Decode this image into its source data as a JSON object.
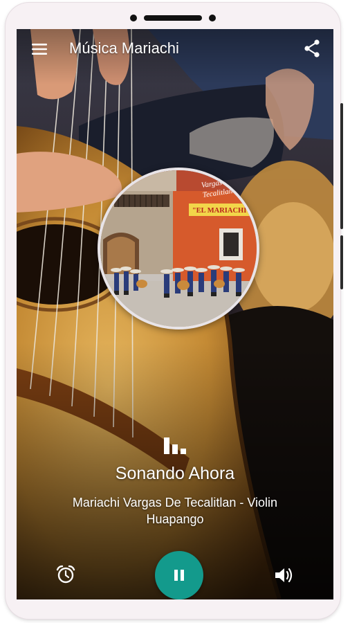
{
  "app_bar": {
    "title": "Música Mariachi",
    "menu_icon": "hamburger-menu-icon",
    "share_icon": "share-icon"
  },
  "album_art": {
    "sign_text": "\"EL MARIACHI\"",
    "logo_text": "Vargas de Tecalitlan"
  },
  "now_playing": {
    "icon": "equalizer-icon",
    "heading": "Sonando Ahora",
    "track": "Mariachi Vargas De Tecalitlan - Violin Huapango"
  },
  "controls": {
    "alarm_icon": "alarm-clock-icon",
    "play_pause_icon": "pause-icon",
    "volume_icon": "volume-icon",
    "accent_color": "#139a8c"
  }
}
